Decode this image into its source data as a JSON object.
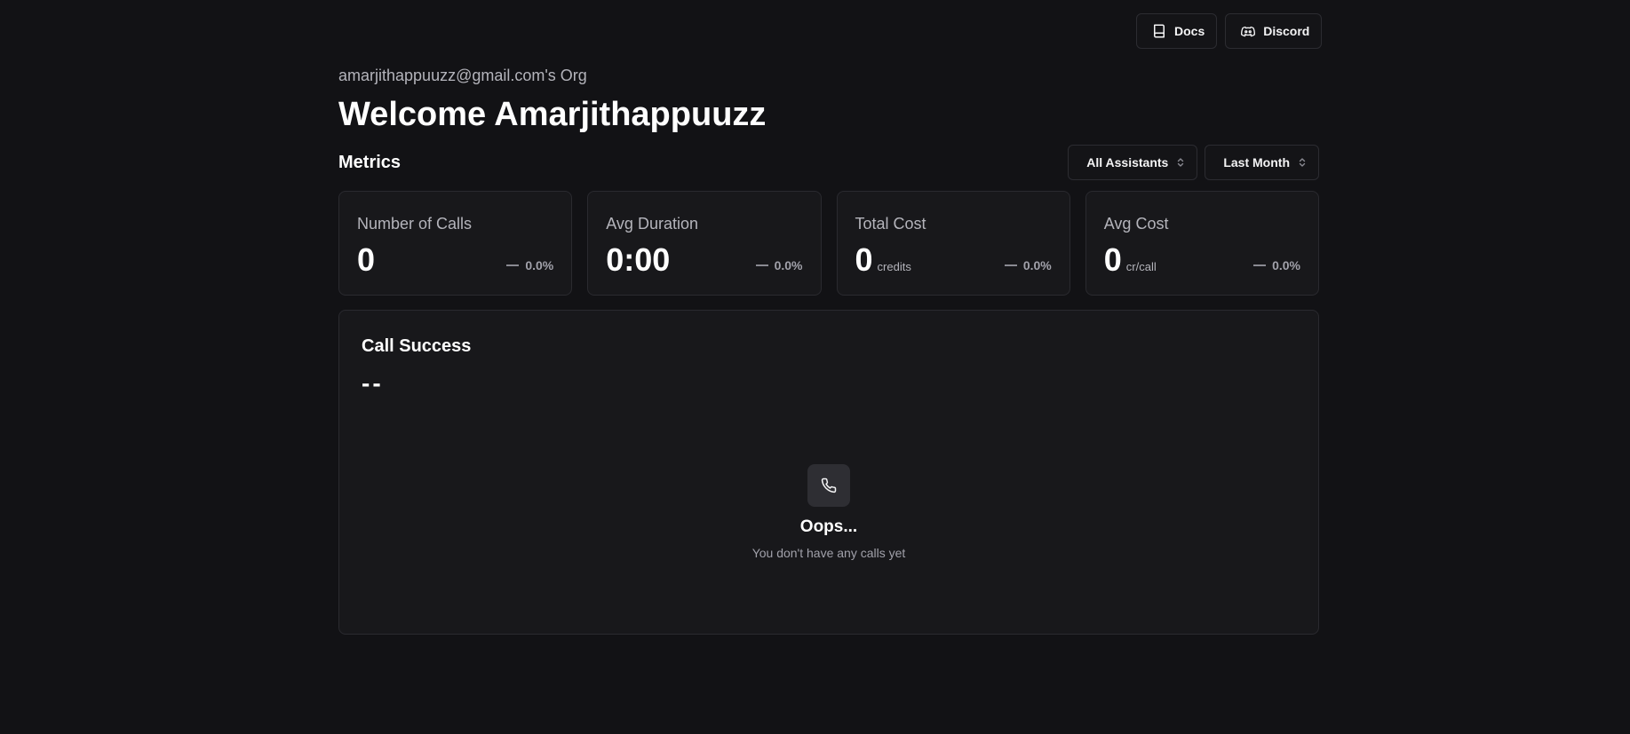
{
  "header": {
    "docs_label": "Docs",
    "discord_label": "Discord",
    "docs_icon": "book-icon",
    "discord_icon": "discord-icon"
  },
  "org_name": "amarjithappuuzz@gmail.com's Org",
  "welcome_title": "Welcome Amarjithappuuzz",
  "metrics": {
    "title": "Metrics",
    "filters": {
      "assistant": "All Assistants",
      "period": "Last Month"
    },
    "cards": [
      {
        "label": "Number of Calls",
        "value": "0",
        "unit": "",
        "change": "0.0%"
      },
      {
        "label": "Avg Duration",
        "value": "0:00",
        "unit": "",
        "change": "0.0%"
      },
      {
        "label": "Total Cost",
        "value": "0",
        "unit": "credits",
        "change": "0.0%"
      },
      {
        "label": "Avg Cost",
        "value": "0",
        "unit": "cr/call",
        "change": "0.0%"
      }
    ]
  },
  "call_success": {
    "title": "Call Success",
    "value": "--",
    "empty_icon": "phone-icon",
    "empty_title": "Oops...",
    "empty_subtitle": "You don't have any calls yet"
  },
  "colors": {
    "background": "#121215",
    "card": "#18181b",
    "border": "#2a2a2f",
    "muted_text": "#b4b4bb"
  }
}
